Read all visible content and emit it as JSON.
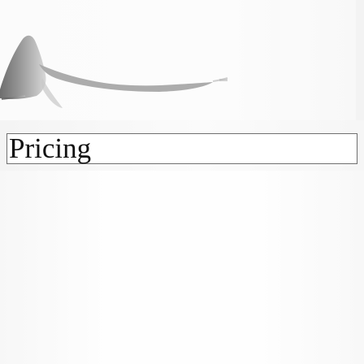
{
  "page": {
    "section_title": "Pricing"
  },
  "hero": {
    "image_name": "product-hero-image"
  }
}
